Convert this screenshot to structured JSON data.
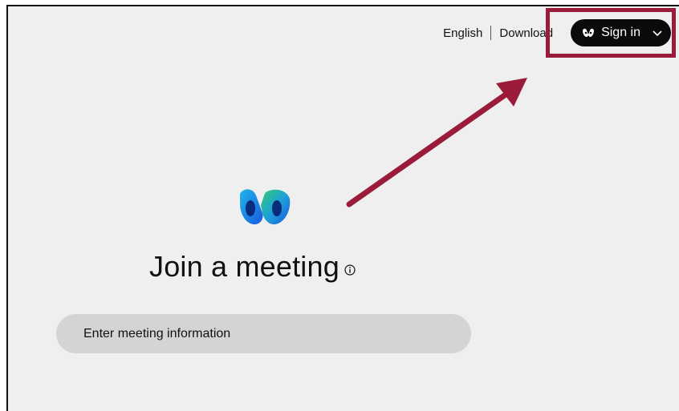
{
  "header": {
    "language": "English",
    "download": "Download",
    "sign_in": "Sign in"
  },
  "main": {
    "title": "Join a meeting",
    "meeting_input_placeholder": "Enter meeting information"
  },
  "icons": {
    "logo": "webex-logo-icon",
    "info": "info-icon",
    "chevron": "chevron-down-icon",
    "user": "webex-mini-icon"
  },
  "colors": {
    "accent_annotation": "#9b1b3b",
    "button_bg": "#0b0b0b",
    "page_bg": "#efefef"
  }
}
